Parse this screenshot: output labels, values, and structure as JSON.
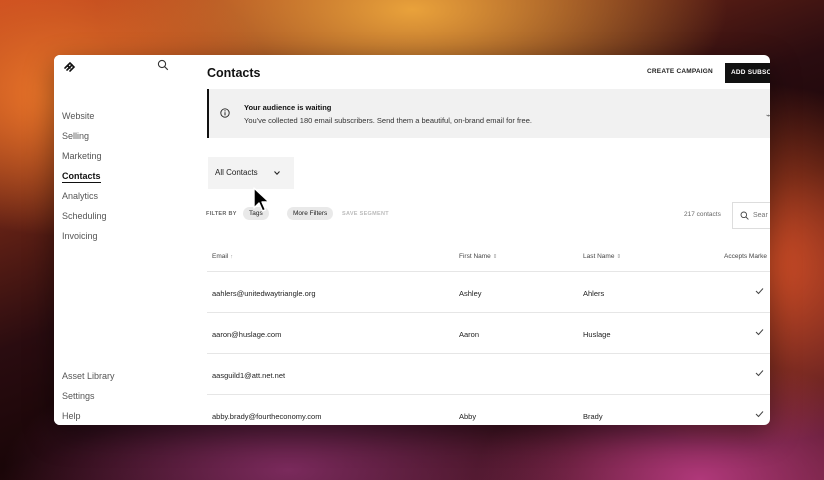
{
  "sidebar": {
    "nav_items": [
      "Website",
      "Selling",
      "Marketing",
      "Contacts",
      "Analytics",
      "Scheduling",
      "Invoicing"
    ],
    "active_item": "Contacts",
    "bottom_items": [
      "Asset Library",
      "Settings",
      "Help"
    ]
  },
  "header": {
    "title": "Contacts",
    "create_campaign": "CREATE CAMPAIGN",
    "add_subscribers": "ADD SUBSC"
  },
  "banner": {
    "title": "Your audience is waiting",
    "text": "You've collected 180 email subscribers. Send them a beautiful, on-brand email for free."
  },
  "dropdown": {
    "label": "All Contacts"
  },
  "filters": {
    "filter_by": "FILTER BY",
    "tags": "Tags",
    "more_filters": "More Filters",
    "save_segment": "SAVE SEGMENT",
    "count": "217 contacts",
    "search_placeholder": "Sear"
  },
  "table": {
    "columns": [
      {
        "label": "Email",
        "sort": "↑"
      },
      {
        "label": "First Name",
        "sort": "⇕"
      },
      {
        "label": "Last Name",
        "sort": "⇕"
      },
      {
        "label": "Accepts Marke",
        "sort": ""
      }
    ],
    "rows": [
      {
        "email": "aahlers@unitedwaytriangle.org",
        "first": "Ashley",
        "last": "Ahlers",
        "accepts": true
      },
      {
        "email": "aaron@huslage.com",
        "first": "Aaron",
        "last": "Huslage",
        "accepts": true
      },
      {
        "email": "aasguild1@att.net.net",
        "first": "",
        "last": "",
        "accepts": true
      },
      {
        "email": "abby.brady@fourtheconomy.com",
        "first": "Abby",
        "last": "Brady",
        "accepts": true
      }
    ]
  }
}
